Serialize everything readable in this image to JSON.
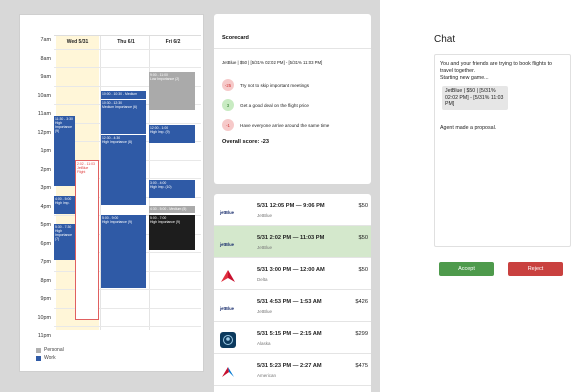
{
  "calendar": {
    "days": [
      "Wed 5/31",
      "Thu 6/1",
      "Fri 6/2"
    ],
    "hours": [
      "7am",
      "8am",
      "9am",
      "10am",
      "11am",
      "12pm",
      "1pm",
      "2pm",
      "3pm",
      "4pm",
      "5pm",
      "6pm",
      "7pm",
      "8pm",
      "9pm",
      "10pm",
      "11pm"
    ],
    "events": {
      "e1": {
        "time": "9:00 - 11:00",
        "label": "Low Importance (2)"
      },
      "e2": {
        "time": "10:00 - 10:30 - Medium",
        "label": ""
      },
      "e3": {
        "time": "10:30 - 12:30",
        "label": "Medium Importance (6)"
      },
      "e4": {
        "time": "11:30 - 3:30",
        "label": "High Importance (9)"
      },
      "e5": {
        "time": "12:00 - 1:00",
        "label": "High Imp. (9)"
      },
      "e6": {
        "time": "12:30 - 4:30",
        "label": "High Importance (8)"
      },
      "e7": {
        "time": "2:02 - 11:03",
        "label": "JetBlue Flight"
      },
      "e8": {
        "time": "3:00 - 4:00",
        "label": "High Imp. (10)"
      },
      "e9": {
        "time": "4:00 - 5:00",
        "label": "High Imp."
      },
      "e10": {
        "time": "4:30 - 5:00 - Medium (5)",
        "label": ""
      },
      "e11": {
        "time": "5:00 - 9:00",
        "label": "High Importance (9)"
      },
      "e12": {
        "time": "5:00 - 7:00",
        "label": "High Importance (9)"
      },
      "e13": {
        "time": "5:30 - 7:30",
        "label": "High Importance (7)"
      }
    },
    "legend": {
      "personal": "Personal",
      "work": "Work",
      "personal_color": "#b0b0b0",
      "work_color": "#2f5aa6"
    }
  },
  "scorecard": {
    "title": "Scorecard",
    "proposal": "JetBlue | $50 | [5/31% 02:02 PM] - [5/31% 11:03 PM]",
    "items": [
      {
        "score": "-25",
        "text": "Try not to skip important meetings",
        "bg": "#f6c9c9",
        "fg": "#d03030"
      },
      {
        "score": "3",
        "text": "Get a good deal on the flight price",
        "bg": "#c8ebc2",
        "fg": "#2f7a2a"
      },
      {
        "score": "-1",
        "text": "Have everyone arrive around the same time",
        "bg": "#f6c9c9",
        "fg": "#d03030"
      }
    ],
    "overall": "Overall score: -23"
  },
  "flights": [
    {
      "logo": "jetBlue",
      "time": "5/31 12:05 PM — 9:06 PM",
      "airline": "JetBlue",
      "price": "$50"
    },
    {
      "logo": "jetBlue",
      "time": "5/31 2:02 PM — 11:03 PM",
      "airline": "JetBlue",
      "price": "$50"
    },
    {
      "logo": "",
      "time": "5/31 3:00 PM — 12:00 AM",
      "airline": "Delta",
      "price": "$50"
    },
    {
      "logo": "jetBlue",
      "time": "5/31 4:53 PM — 1:53 AM",
      "airline": "JetBlue",
      "price": "$426"
    },
    {
      "logo": "",
      "time": "5/31 5:15 PM — 2:15 AM",
      "airline": "Alaska",
      "price": "$299"
    },
    {
      "logo": "",
      "time": "5/31 5:23 PM — 2:27 AM",
      "airline": "American",
      "price": "$475"
    }
  ],
  "chat": {
    "title": "Chat",
    "intro": "You and your friends are trying to book flights to travel together.",
    "start": "Starting new game...",
    "proposal": "JetBlue | $50 | [5/31% 02:02 PM] - [5/31% 11:03 PM]",
    "status": "Agent made a proposal.",
    "accept": "Accept",
    "reject": "Reject"
  }
}
